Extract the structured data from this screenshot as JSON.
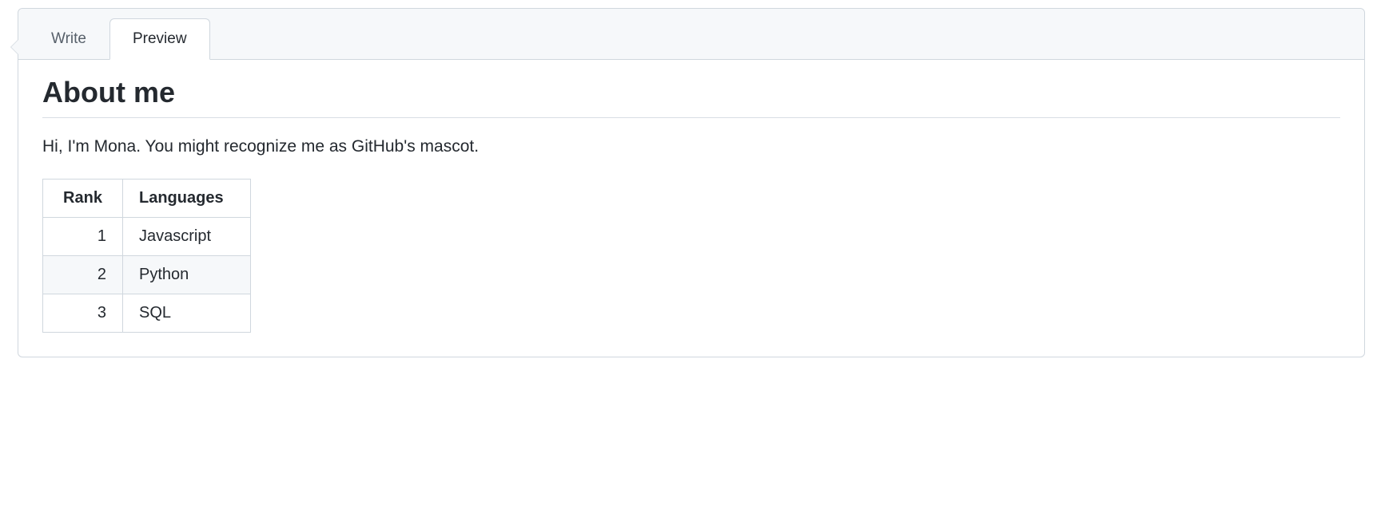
{
  "tabs": {
    "write": "Write",
    "preview": "Preview"
  },
  "content": {
    "heading": "About me",
    "intro": "Hi, I'm Mona. You might recognize me as GitHub's mascot."
  },
  "table": {
    "headers": {
      "rank": "Rank",
      "languages": "Languages"
    },
    "rows": [
      {
        "rank": "1",
        "language": "Javascript"
      },
      {
        "rank": "2",
        "language": "Python"
      },
      {
        "rank": "3",
        "language": "SQL"
      }
    ]
  }
}
